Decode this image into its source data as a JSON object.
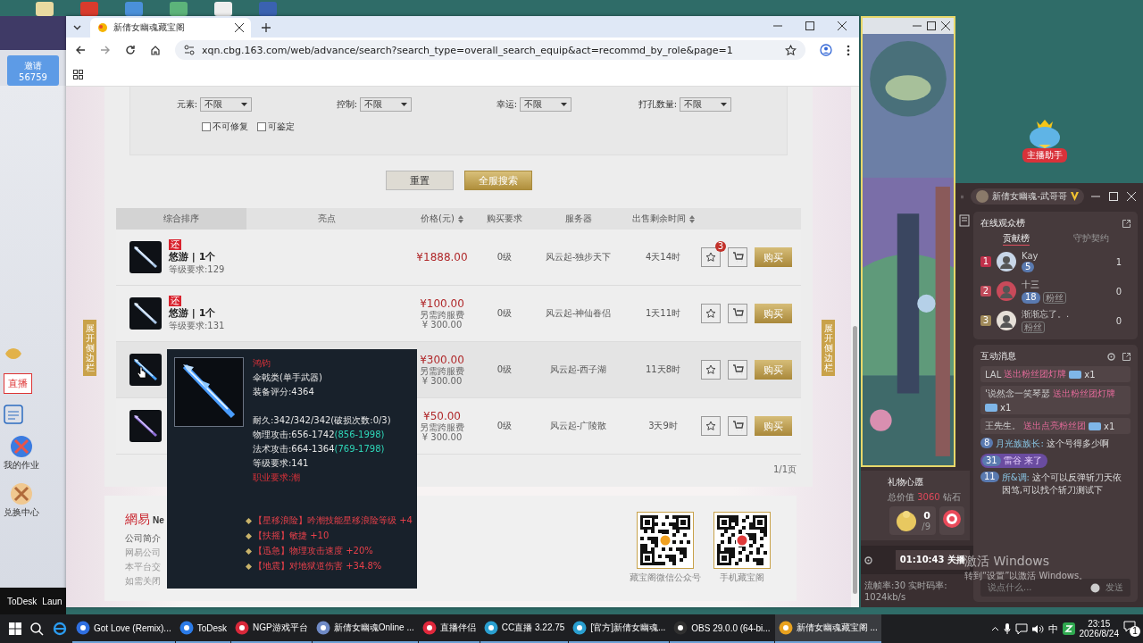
{
  "desktop": {
    "left_app": {
      "invite_label": "邀请",
      "invite_count": "56759",
      "live_label": "直播",
      "shortcuts": [
        "我的作业",
        "兑换中心"
      ],
      "bottom_items": [
        "ToDesk",
        "Laun"
      ]
    },
    "watermark": [
      "激活 Windows",
      "转到“设置”以激活 Windows。"
    ]
  },
  "browser": {
    "tab_title": "新倩女幽魂藏宝阁",
    "url": "xqn.cbg.163.com/web/advance/search?search_type=overall_search_equip&act=recommd_by_role&page=1"
  },
  "page": {
    "side_tabs": [
      "展开侧边栏",
      "展开侧边栏"
    ],
    "filters": [
      {
        "label": "元素:",
        "value": "不限"
      },
      {
        "label": "控制:",
        "value": "不限"
      },
      {
        "label": "幸运:",
        "value": "不限"
      },
      {
        "label": "打孔数量:",
        "value": "不限"
      }
    ],
    "checkboxes": [
      {
        "label": "不可修复",
        "checked": false
      },
      {
        "label": "可鉴定",
        "checked": false
      }
    ],
    "buttons": [
      {
        "label": "重置",
        "kind": "secondary"
      },
      {
        "label": "全服搜索",
        "kind": "primary"
      }
    ],
    "columns": [
      {
        "label": "综合排序",
        "selected": true,
        "sortable": false
      },
      {
        "label": "亮点",
        "selected": false,
        "sortable": false
      },
      {
        "label": "价格(元)",
        "selected": false,
        "sortable": true
      },
      {
        "label": "购买要求",
        "selected": false,
        "sortable": false
      },
      {
        "label": "服务器",
        "selected": false,
        "sortable": false
      },
      {
        "label": "出售剩余时间",
        "selected": false,
        "sortable": true
      }
    ],
    "rows": [
      {
        "kind": "blue",
        "tag": "还",
        "name": "悠游 | 1个",
        "level_req": "等级要求:129",
        "price": "¥1888.00",
        "requirement": "0级",
        "server": "风云起-独步天下",
        "time_left": "4天14时",
        "favorites": "3",
        "hovered": false,
        "buy": "购买"
      },
      {
        "kind": "blue",
        "tag": "还",
        "name": "悠游 | 1个",
        "level_req": "等级要求:131",
        "price": "¥100.00",
        "fee_label": "另需跨服费",
        "fee": "¥ 300.00",
        "requirement": "0级",
        "server": "风云起-神仙眷侣",
        "time_left": "1天11时",
        "hovered": false,
        "buy": "购买"
      },
      {
        "kind": "ice",
        "price": "¥300.00",
        "fee_label": "另需跨服费",
        "fee": "¥ 300.00",
        "requirement": "0级",
        "server": "风云起-西子湖",
        "time_left": "11天8时",
        "hovered": true,
        "buy": "购买"
      },
      {
        "kind": "purple",
        "price": "¥50.00",
        "fee_label": "另需跨服费",
        "fee": "¥ 300.00",
        "requirement": "0级",
        "server": "风云起-广陵散",
        "time_left": "3天9时",
        "hovered": false,
        "buy": "购买"
      }
    ],
    "pagination": "1/1页",
    "tooltip": {
      "name": "鸿钧",
      "type": "伞戟类(单手武器)",
      "score": "装备评分:4364",
      "stats": [
        {
          "text": "耐久:342/342/342(破损次数:0/3)"
        },
        {
          "text": "物理攻击:656-1742",
          "bonus": "(856-1998)"
        },
        {
          "text": "法术攻击:664-1364",
          "bonus": "(769-1798)"
        },
        {
          "text": "等级要求:141"
        }
      ],
      "job_req": "职业要求:潮",
      "effects": [
        "【星移浪险】吟潮技能星移浪险等级 +4",
        "【扶摇】敏捷 +10",
        "【迅急】物理攻击速度 +20%",
        "【地震】对地狱道伤害 +34.8%"
      ]
    },
    "footer": {
      "logo": "網易",
      "logo_suffix": "Ne",
      "lines": [
        "公司简介",
        "网易公司",
        "本平台交",
        "如需关闭"
      ],
      "qr_codes": [
        {
          "caption": "藏宝阁微信公众号",
          "kind": "wechat"
        },
        {
          "caption": "手机藏宝阁",
          "kind": "app"
        }
      ]
    }
  },
  "stream_app": {
    "title": "新倩女幽魂-武哥哥",
    "assistant_label": "主播助手",
    "audience": {
      "title": "在线观众榜",
      "tabs": [
        {
          "label": "贡献榜",
          "selected": true
        },
        {
          "label": "守护契约",
          "selected": false
        }
      ],
      "viewers": [
        {
          "rank": "1",
          "name": "Kay",
          "level": "5",
          "score": "1"
        },
        {
          "rank": "2",
          "name": "十三",
          "level": "18",
          "fan_label": "粉丝",
          "score": "0"
        },
        {
          "rank": "3",
          "name": "渐渐忘了。.",
          "fan_label": "粉丝",
          "score": "0"
        }
      ]
    },
    "messages_title": "互动消息",
    "gifts": [
      {
        "user": "LAL",
        "action": "送出粉丝团灯牌",
        "count": "x1"
      },
      {
        "user": "'说然念一笑琴瑟",
        "action": "送出粉丝团灯牌",
        "count": "x1"
      },
      {
        "user": "王先生。",
        "action": "送出点亮粉丝团",
        "count": "x1"
      }
    ],
    "chats": [
      {
        "kind": "chat",
        "level": "8",
        "user": "月光族族长:",
        "text": "这个号得多少啊"
      },
      {
        "kind": "join",
        "level": "31",
        "user": "雷谷",
        "text": "来了"
      },
      {
        "kind": "chat",
        "level": "11",
        "user": "所&调:",
        "text": "这个可以反弹斩刀天依因笃,可以找个斩刀测试下"
      }
    ],
    "input_placeholder": "说点什么...",
    "send_label": "发送",
    "wish": {
      "title": "礼物心愿",
      "total_prefix": "总价值",
      "total_value": "3060",
      "total_suffix": "钻石",
      "count": "0",
      "count_sub": "/9"
    },
    "live_timer": "01:10:43 关播",
    "stats": "流帧率:30 实时码率: 1024kb/s"
  },
  "taskbar": {
    "items": [
      {
        "label": "Got Love (Remix)...",
        "kind": "music",
        "selected": false
      },
      {
        "label": "ToDesk",
        "kind": "todesk",
        "selected": false
      },
      {
        "label": "NGP游戏平台",
        "kind": "ngp",
        "selected": false
      },
      {
        "label": "新倩女幽魂Online ...",
        "kind": "game",
        "selected": false
      },
      {
        "label": "直播伴侣",
        "kind": "live",
        "selected": false
      },
      {
        "label": "CC直播 3.22.75",
        "kind": "cc",
        "selected": false
      },
      {
        "label": "[官方]新倩女幽魂...",
        "kind": "cc",
        "selected": false
      },
      {
        "label": "OBS 29.0.0 (64-bi...",
        "kind": "obs",
        "selected": false
      },
      {
        "label": "新倩女幽魂藏宝阁 ...",
        "kind": "chrome",
        "selected": true
      }
    ],
    "ime": "中",
    "time": "23:15",
    "date": "2026/8/24",
    "notifications": "1"
  }
}
